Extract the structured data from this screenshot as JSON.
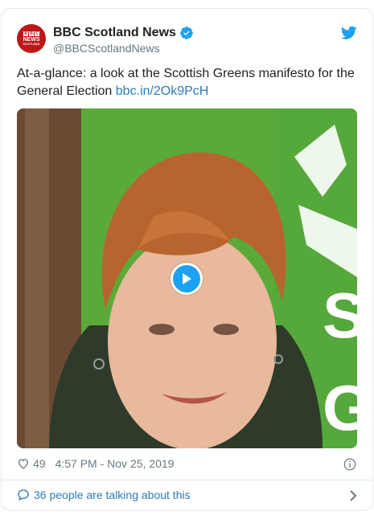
{
  "account": {
    "display_name": "BBC Scotland News",
    "handle": "@BBCScotlandNews",
    "avatar": {
      "blocks": [
        "B",
        "B",
        "C"
      ],
      "line1": "NEWS",
      "line2": "SCOTLAND"
    },
    "verified_icon": "verified-badge-icon"
  },
  "tweet": {
    "text": "At-a-glance: a look at the Scottish Greens manifesto for the General Election ",
    "link": "bbc.in/2Ok9PcH",
    "media": {
      "type": "video",
      "background_text": "SC G",
      "accent_color": "#4ea53a"
    }
  },
  "meta": {
    "likes": "49",
    "timestamp": "4:57 PM - Nov 25, 2019"
  },
  "footer": {
    "talking_text": "36 people are talking about this"
  },
  "icons": {
    "brand": "twitter-bird-icon",
    "like": "heart-icon",
    "info": "info-icon",
    "reply": "speech-bubble-icon",
    "expand": "chevron-right-icon",
    "play": "play-icon"
  },
  "colors": {
    "link": "#2b7bb9",
    "twitter_blue": "#1da1f2",
    "bbc_red": "#bb1919",
    "secondary_text": "#697882"
  }
}
